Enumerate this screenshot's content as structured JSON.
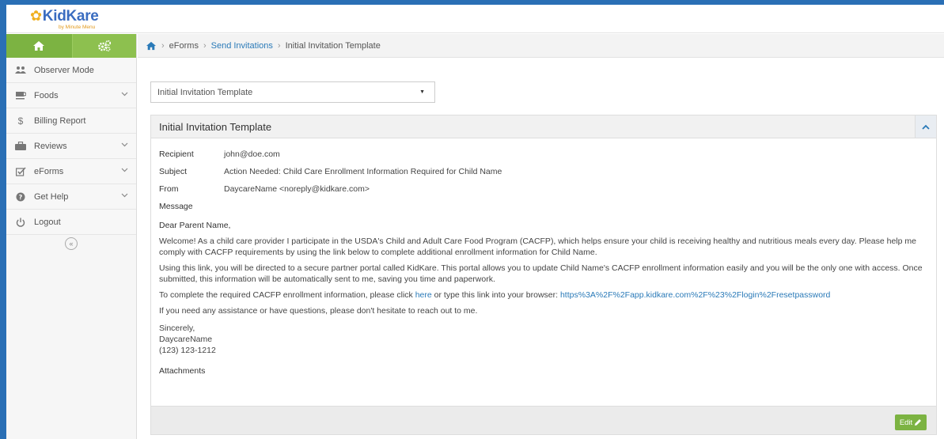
{
  "app": {
    "logo_text": "KidKare",
    "logo_sub": "by Minute Menu"
  },
  "sidebar": {
    "items": [
      {
        "label": "Observer Mode",
        "icon": "users-icon",
        "expandable": false
      },
      {
        "label": "Foods",
        "icon": "cup-icon",
        "expandable": true
      },
      {
        "label": "Billing Report",
        "icon": "dollar-icon",
        "expandable": false
      },
      {
        "label": "Reviews",
        "icon": "briefcase-icon",
        "expandable": true
      },
      {
        "label": "eForms",
        "icon": "checkbox-icon",
        "expandable": true
      },
      {
        "label": "Get Help",
        "icon": "question-icon",
        "expandable": true
      },
      {
        "label": "Logout",
        "icon": "power-icon",
        "expandable": false
      }
    ],
    "collapse_symbol": "«"
  },
  "breadcrumb": {
    "items": [
      "eForms",
      "Send Invitations",
      "Initial Invitation Template"
    ]
  },
  "template_select": {
    "value": "Initial Invitation Template"
  },
  "panel": {
    "title": "Initial Invitation Template",
    "recipient_label": "Recipient",
    "recipient_value": "john@doe.com",
    "subject_label": "Subject",
    "subject_value": "Action Needed: Child Care Enrollment Information Required for Child Name",
    "from_label": "From",
    "from_value": "DaycareName <noreply@kidkare.com>",
    "message_label": "Message",
    "greeting": "Dear Parent Name,",
    "paragraph1": "Welcome! As a child care provider I participate in the USDA's Child and Adult Care Food Program (CACFP), which helps ensure your child is receiving healthy and nutritious meals every day. Please help me comply with CACFP requirements by using the link below to complete additional enrollment information for Child Name.",
    "paragraph2": "Using this link, you will be directed to a secure partner portal called KidKare. This portal allows you to update Child Name's CACFP enrollment information easily and you will be the only one with access. Once submitted, this information will be automatically sent to me, saving you time and paperwork.",
    "paragraph3_prefix": "To complete the required CACFP enrollment information, please click ",
    "paragraph3_link1": "here",
    "paragraph3_middle": " or type this link into your browser: ",
    "paragraph3_link2": "https%3A%2F%2Fapp.kidkare.com%2F%23%2Flogin%2Fresetpassword",
    "paragraph4": "If you need any assistance or have questions, please don't hesitate to reach out to me.",
    "signoff": "Sincerely,",
    "signature_name": "DaycareName",
    "signature_phone": "(123) 123-1212",
    "attachments_label": "Attachments",
    "edit_label": "Edit"
  },
  "colors": {
    "accent_green": "#7cb342",
    "link_blue": "#2a7ab8",
    "frame_blue": "#2a6fb5"
  }
}
